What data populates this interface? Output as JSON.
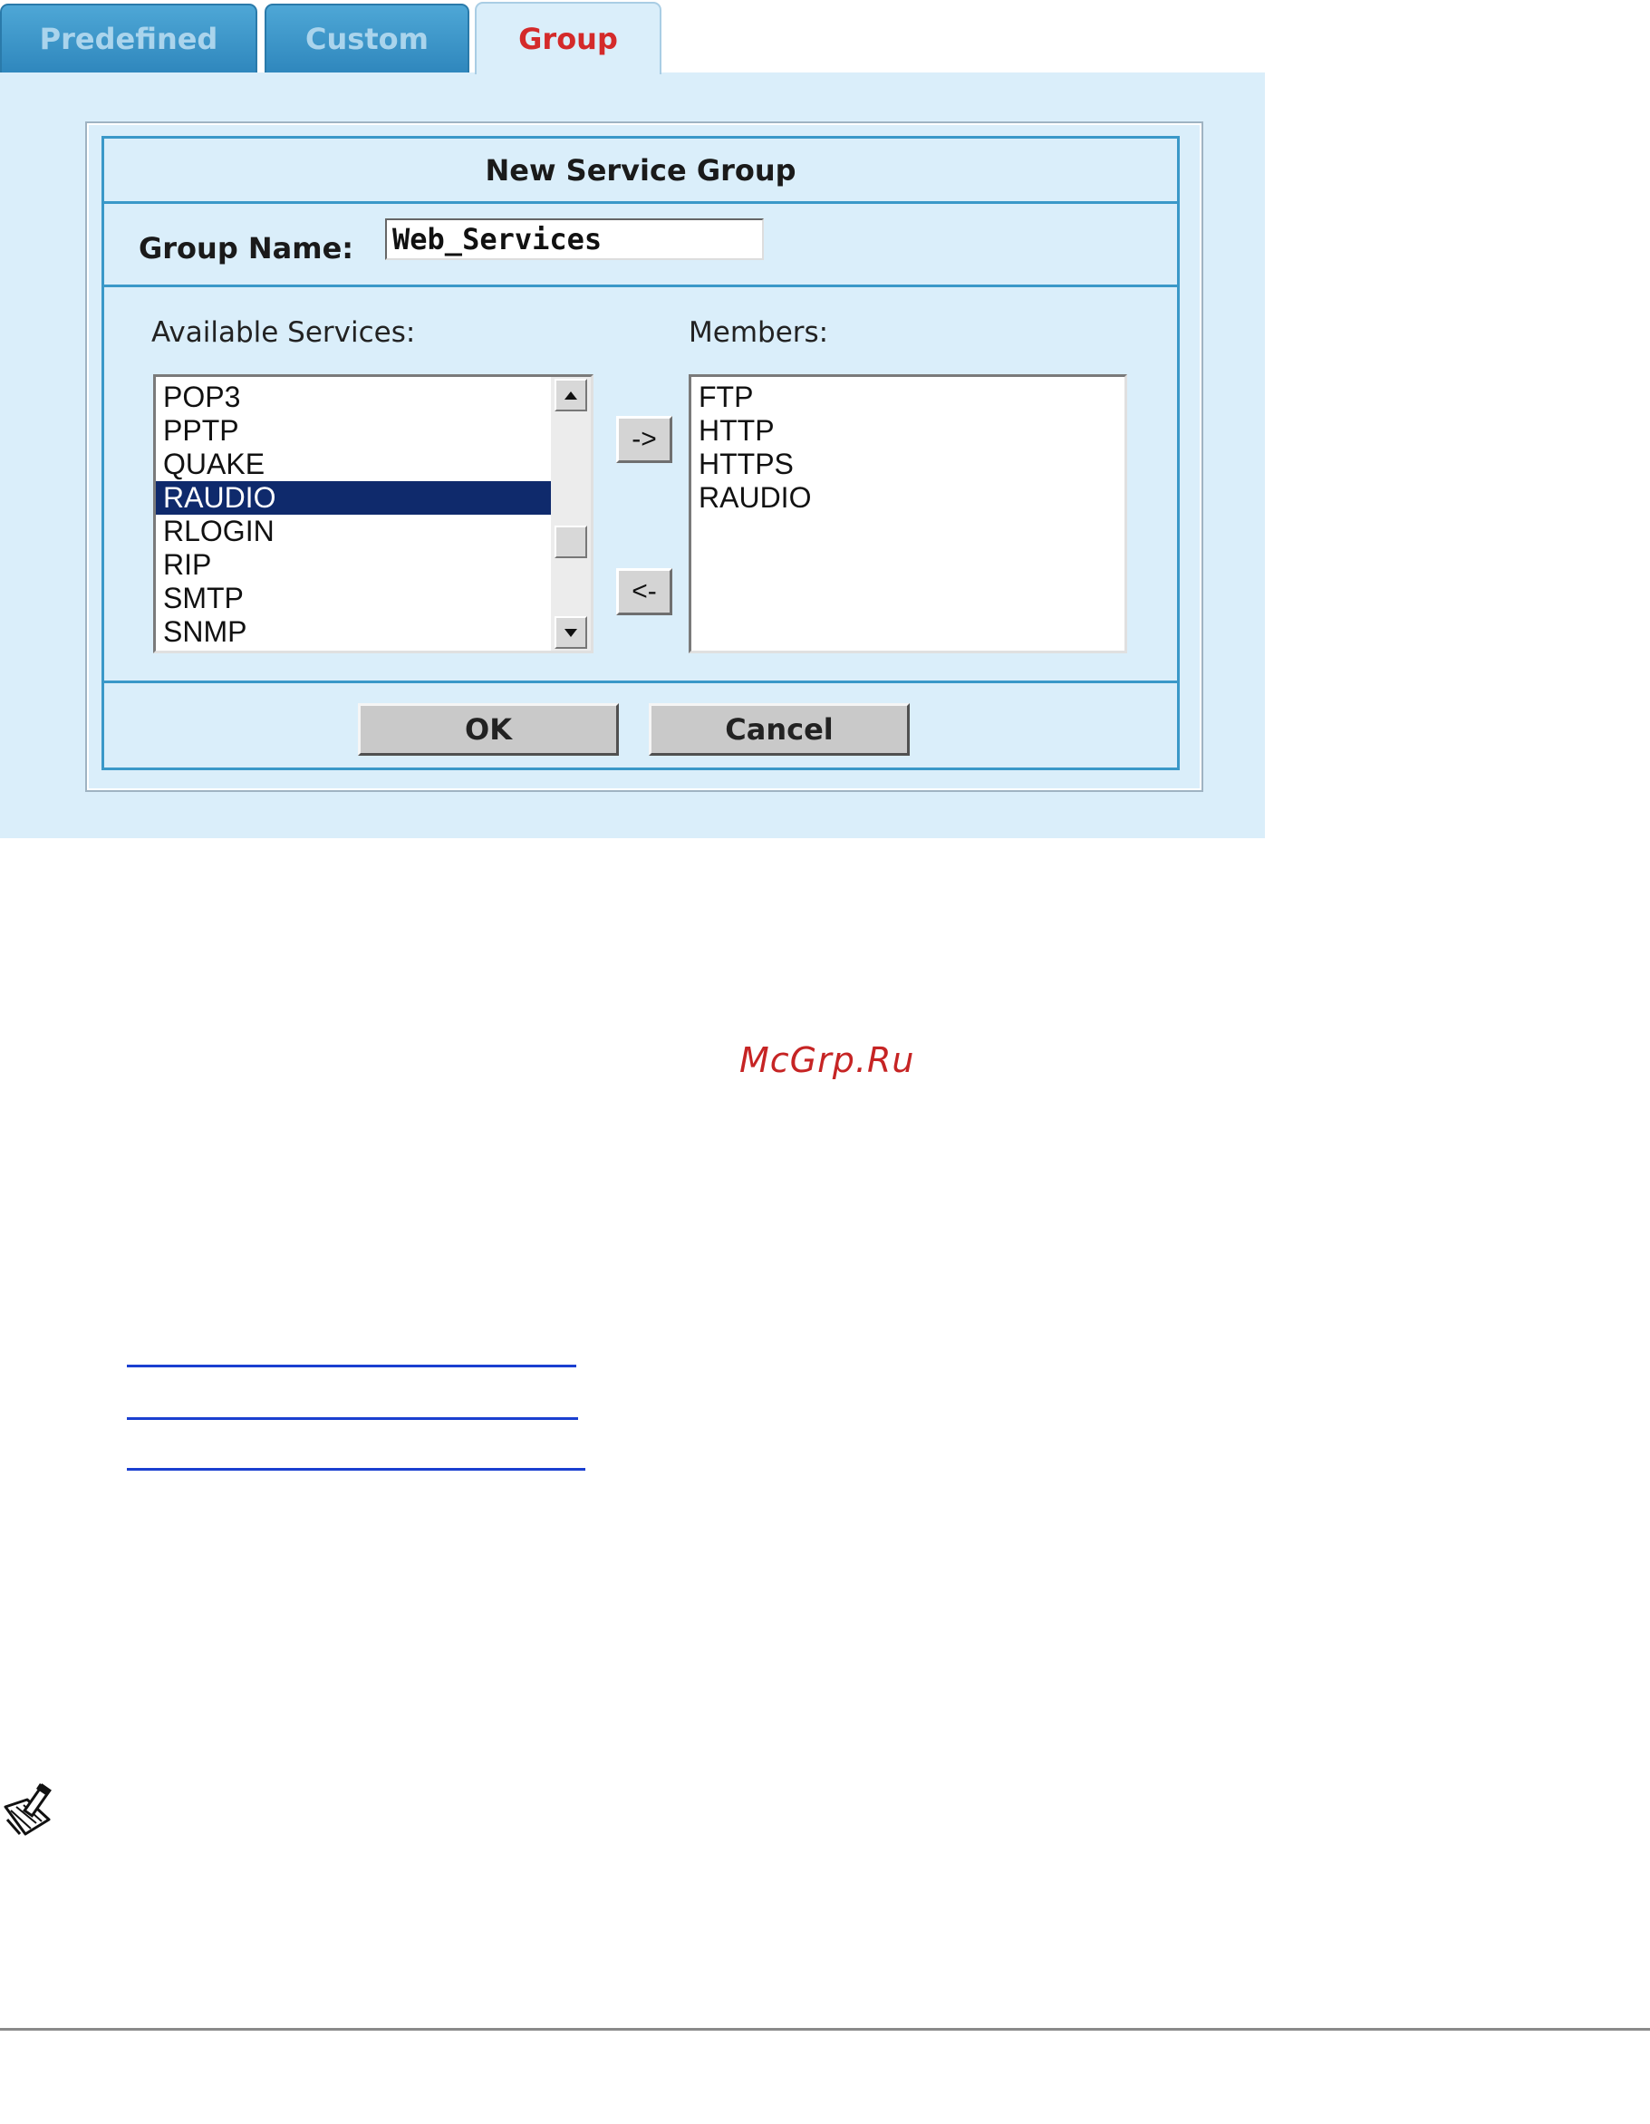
{
  "tabs": [
    {
      "label": "Predefined",
      "active": false
    },
    {
      "label": "Custom",
      "active": false
    },
    {
      "label": "Group",
      "active": true
    }
  ],
  "dialog": {
    "title": "New Service Group",
    "group_name_label": "Group Name:",
    "group_name_value": "Web_Services",
    "available_label": "Available Services:",
    "members_label": "Members:",
    "available_services": [
      "POP3",
      "PPTP",
      "QUAKE",
      "RAUDIO",
      "RLOGIN",
      "RIP",
      "SMTP",
      "SNMP"
    ],
    "selected_available": "RAUDIO",
    "members": [
      "FTP",
      "HTTP",
      "HTTPS",
      "RAUDIO"
    ],
    "add_button": "->",
    "remove_button": "<-",
    "ok_button": "OK",
    "cancel_button": "Cancel"
  },
  "watermark": "McGrp.Ru",
  "icons": {
    "note": "note-pencil-icon",
    "scroll_up": "scroll-up-arrow-icon",
    "scroll_down": "scroll-down-arrow-icon"
  },
  "colors": {
    "active_tab_text": "#d42a2a",
    "inactive_tab": "#3a94c8",
    "panel_bg": "#daeefa",
    "dialog_border": "#3a98c8",
    "selection": "#0f2a6c",
    "watermark": "#c62424",
    "link": "#1a3fd0"
  }
}
